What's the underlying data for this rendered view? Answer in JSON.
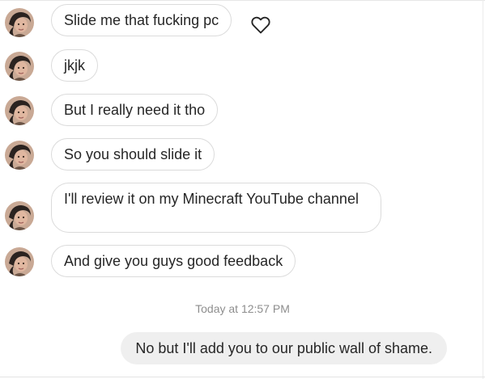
{
  "conversation": {
    "messages": [
      {
        "text": "Slide me that fucking pc",
        "sender": "other",
        "liked": true
      },
      {
        "text": "jkjk",
        "sender": "other"
      },
      {
        "text": "But I really need it tho",
        "sender": "other"
      },
      {
        "text": "So you should slide it",
        "sender": "other"
      },
      {
        "text": "I'll review it on my Minecraft YouTube channel",
        "sender": "other"
      },
      {
        "text": "And give you guys good feedback",
        "sender": "other"
      }
    ],
    "timestamp": "Today at 12:57 PM",
    "reply": {
      "text": "No but I'll add you to our public wall of shame.",
      "sender": "self"
    }
  },
  "icons": {
    "like": "heart-outline-icon",
    "avatar": "user-avatar"
  },
  "colors": {
    "incoming_bubble_border": "#dbdbdb",
    "outgoing_bubble_bg": "#efefef",
    "text": "#262626",
    "timestamp": "#8e8e8e"
  }
}
